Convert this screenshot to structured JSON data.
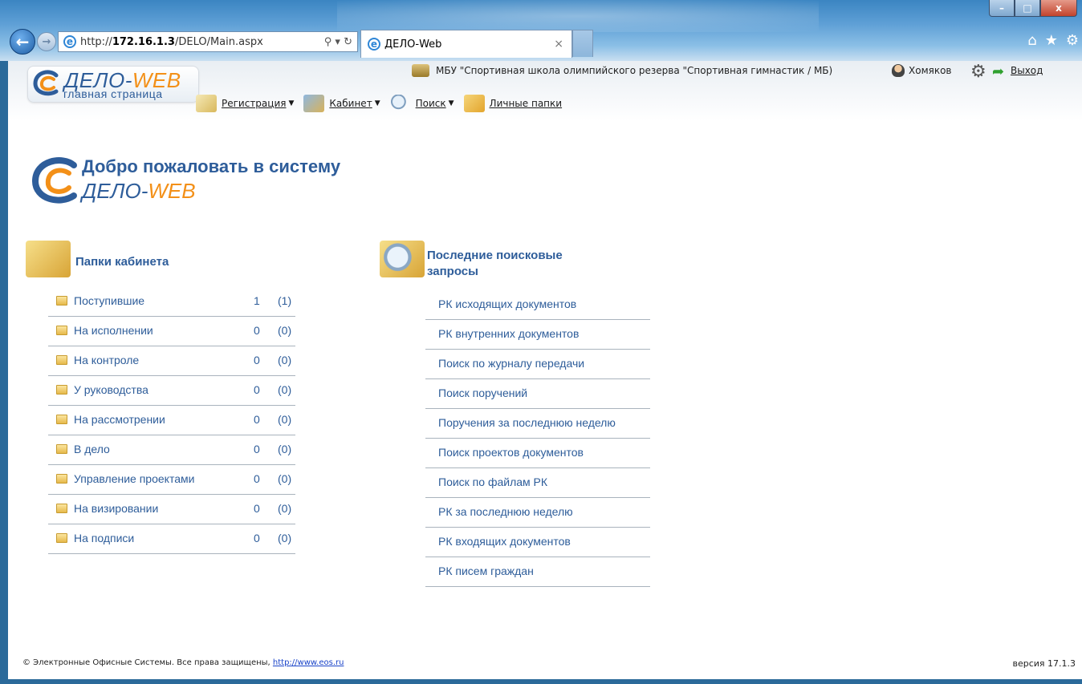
{
  "browser": {
    "url_prefix": "http://",
    "url_host": "172.16.1.3",
    "url_path": "/DELO/Main.aspx",
    "addr_tools": "⚲ ▾ ↻",
    "tab_title": "ДЕЛО-Web",
    "tab_close": "×",
    "home_icon": "⌂",
    "star_icon": "★",
    "gear_icon": "⚙",
    "back_icon": "←",
    "forward_icon": "→",
    "min_icon": "–",
    "max_icon": "□",
    "close_icon": "x"
  },
  "header": {
    "logo_title_part1": "ДЕЛО-",
    "logo_title_part2": "WEB",
    "logo_subtitle": "главная страница",
    "organization": "МБУ \"Спортивная школа олимпийского резерва \"Спортивная гимнастик / МБ)",
    "user_name": "Хомяков",
    "exit_label": "Выход"
  },
  "menu": [
    {
      "label": "Регистрация",
      "has_dropdown": true
    },
    {
      "label": "Кабинет",
      "has_dropdown": true
    },
    {
      "label": "Поиск",
      "has_dropdown": true
    },
    {
      "label": "Личные папки",
      "has_dropdown": false
    }
  ],
  "welcome": {
    "title": "Добро пожаловать в систему",
    "brand_part1": "ДЕЛО-",
    "brand_part2": "WEB"
  },
  "folders_section": {
    "title": "Папки кабинета",
    "items": [
      {
        "name": "Поступившие",
        "count": "1",
        "total": "(1)"
      },
      {
        "name": "На исполнении",
        "count": "0",
        "total": "(0)"
      },
      {
        "name": "На контроле",
        "count": "0",
        "total": "(0)"
      },
      {
        "name": "У руководства",
        "count": "0",
        "total": "(0)"
      },
      {
        "name": "На рассмотрении",
        "count": "0",
        "total": "(0)"
      },
      {
        "name": "В дело",
        "count": "0",
        "total": "(0)"
      },
      {
        "name": "Управление проектами",
        "count": "0",
        "total": "(0)"
      },
      {
        "name": "На визировании",
        "count": "0",
        "total": "(0)"
      },
      {
        "name": "На подписи",
        "count": "0",
        "total": "(0)"
      }
    ]
  },
  "queries_section": {
    "title": "Последние поисковые запросы",
    "items": [
      "РК исходящих документов",
      "РК внутренних документов",
      "Поиск по журналу передачи",
      "Поиск поручений",
      "Поручения за последнюю неделю",
      "Поиск проектов документов",
      "Поиск по файлам РК",
      "РК за последнюю неделю",
      "РК входящих документов",
      "РК писем граждан"
    ]
  },
  "footer": {
    "copyright": "© Электронные Офисные Системы. Все права защищены, ",
    "link": "http://www.eos.ru",
    "version": "версия 17.1.3"
  }
}
